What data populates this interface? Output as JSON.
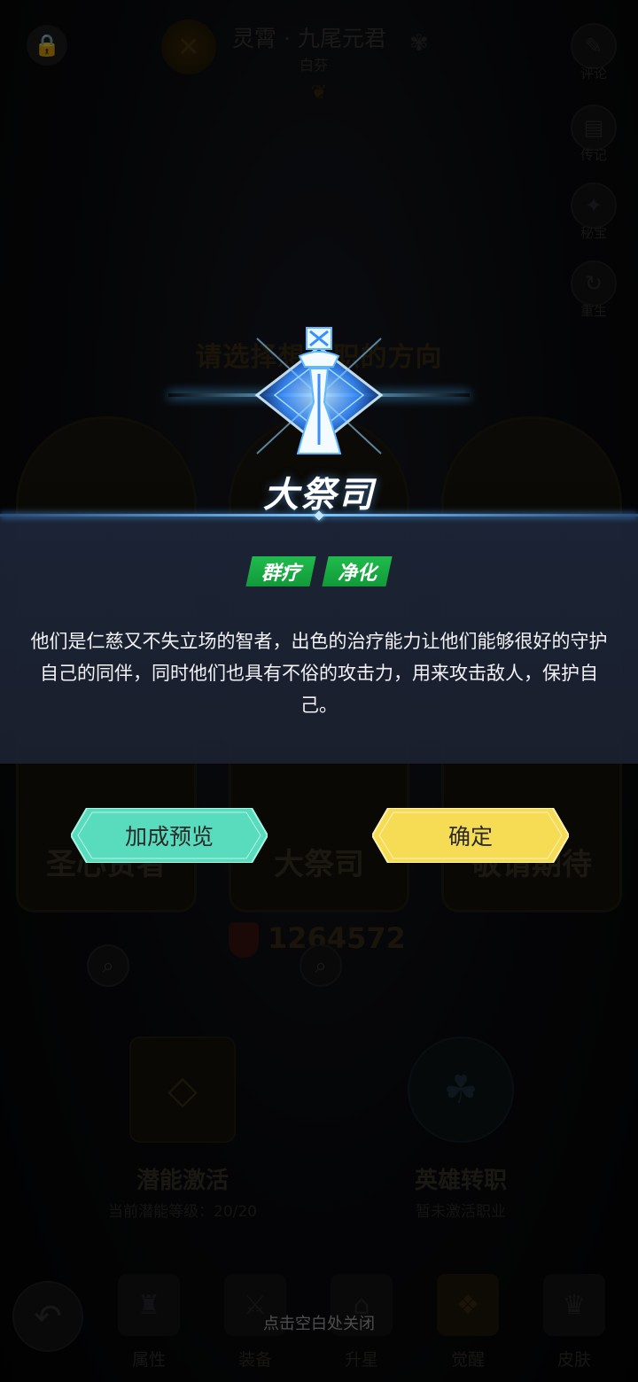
{
  "header": {
    "hero_title": "灵霄 · 九尾元君",
    "hero_subtitle": "白芬"
  },
  "side_buttons": [
    {
      "label": "评论",
      "icon": "comment-icon"
    },
    {
      "label": "传记",
      "icon": "book-icon"
    },
    {
      "label": "秘宝",
      "icon": "treasure-icon"
    },
    {
      "label": "重生",
      "icon": "rebirth-icon"
    }
  ],
  "background": {
    "choose_title": "请选择想转职的方向",
    "cards": [
      "圣心贤者",
      "大祭司",
      "敬请期待"
    ],
    "power_value": "1264572",
    "features": [
      {
        "title": "潜能激活",
        "subtitle": "当前潜能等级：20/20"
      },
      {
        "title": "英雄转职",
        "subtitle": "暂未激活职业"
      }
    ],
    "nav": [
      "属性",
      "装备",
      "升星",
      "觉醒",
      "皮肤"
    ]
  },
  "modal": {
    "class_name": "大祭司",
    "tags": [
      "群疗",
      "净化"
    ],
    "description": "他们是仁慈又不失立场的智者，出色的治疗能力让他们能够很好的守护自己的同伴，同时他们也具有不俗的攻击力，用来攻击敌人，保护自己。",
    "preview_label": "加成预览",
    "confirm_label": "确定",
    "close_hint": "点击空白处关闭"
  },
  "colors": {
    "tag_green": "#1fbb4c",
    "preview_btn": "#5fe0c0",
    "confirm_btn": "#f8df5a",
    "accent_blue": "#7fd0ff"
  }
}
